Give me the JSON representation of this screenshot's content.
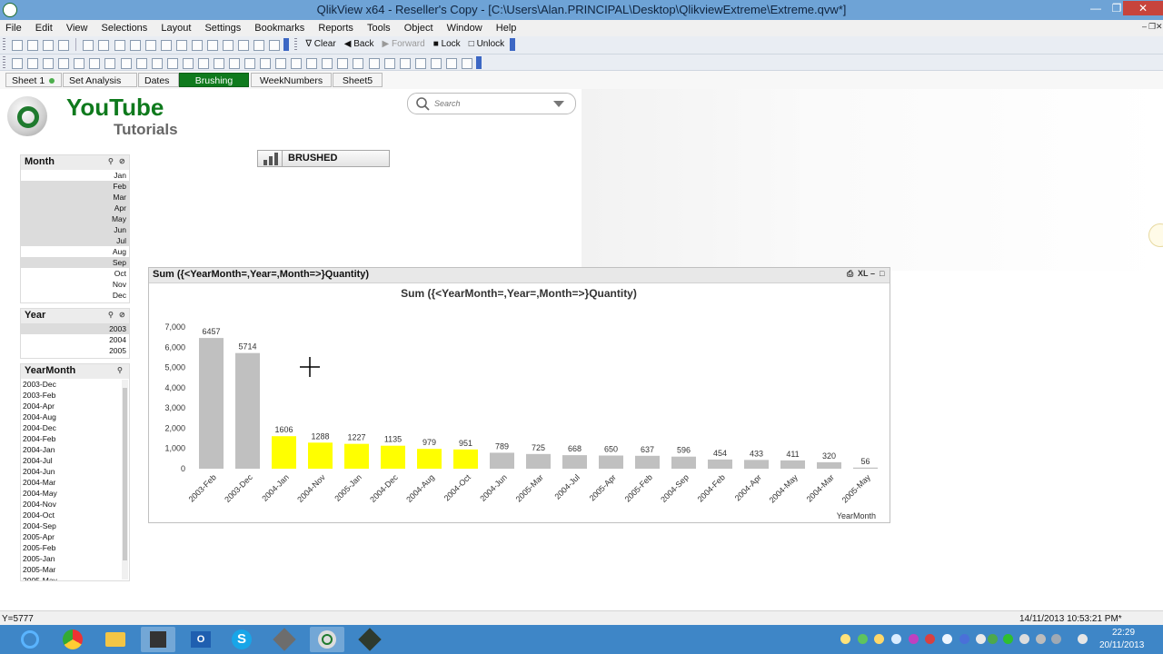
{
  "window": {
    "title": "QlikView x64 - Reseller's Copy - [C:\\Users\\Alan.PRINCIPAL\\Desktop\\QlikviewExtreme\\Extreme.qvw*]",
    "minimize": "—",
    "restore": "❐",
    "close": "✕"
  },
  "menu": [
    "File",
    "Edit",
    "View",
    "Selections",
    "Layout",
    "Settings",
    "Bookmarks",
    "Reports",
    "Tools",
    "Object",
    "Window",
    "Help"
  ],
  "menu_right": {
    "min": "‒",
    "restore": "❐",
    "close": "✕"
  },
  "toolbar": {
    "clear": "Clear",
    "back": "Back",
    "forward": "Forward",
    "lock": "Lock",
    "unlock": "Unlock"
  },
  "tabs": [
    {
      "label": "Sheet 1"
    },
    {
      "label": "Set Analysis"
    },
    {
      "label": "Dates"
    },
    {
      "label": "Brushing"
    },
    {
      "label": "WeekNumbers"
    },
    {
      "label": "Sheet5"
    }
  ],
  "logo": {
    "line1": "YouTube",
    "line2": "Tutorials"
  },
  "search": {
    "placeholder": "Search"
  },
  "brushed_button": {
    "label": "BRUSHED"
  },
  "month_box": {
    "title": "Month",
    "items": [
      {
        "label": "Jan",
        "selected": false
      },
      {
        "label": "Feb",
        "selected": true
      },
      {
        "label": "Mar",
        "selected": true
      },
      {
        "label": "Apr",
        "selected": true
      },
      {
        "label": "May",
        "selected": true
      },
      {
        "label": "Jun",
        "selected": true
      },
      {
        "label": "Jul",
        "selected": true
      },
      {
        "label": "Aug",
        "selected": false
      },
      {
        "label": "Sep",
        "selected": true
      },
      {
        "label": "Oct",
        "selected": false
      },
      {
        "label": "Nov",
        "selected": false
      },
      {
        "label": "Dec",
        "selected": false
      }
    ]
  },
  "year_box": {
    "title": "Year",
    "items": [
      {
        "label": "2003",
        "selected": true
      },
      {
        "label": "2004",
        "selected": false
      },
      {
        "label": "2005",
        "selected": false
      }
    ]
  },
  "yearmonth_box": {
    "title": "YearMonth",
    "items": [
      "2003-Dec",
      "2003-Feb",
      "2004-Apr",
      "2004-Aug",
      "2004-Dec",
      "2004-Feb",
      "2004-Jan",
      "2004-Jul",
      "2004-Jun",
      "2004-Mar",
      "2004-May",
      "2004-Nov",
      "2004-Oct",
      "2004-Sep",
      "2005-Apr",
      "2005-Feb",
      "2005-Jan",
      "2005-Mar",
      "2005-May"
    ]
  },
  "chart_caption": {
    "text": "Sum ({<YearMonth=,Year=,Month=>}Quantity)",
    "xl": "XL"
  },
  "chart_data": {
    "type": "bar",
    "title": "Sum ({<YearMonth=,Year=,Month=>}Quantity)",
    "xlabel": "YearMonth",
    "ylabel": "",
    "ylim": [
      0,
      7000
    ],
    "yticks": [
      "0",
      "1,000",
      "2,000",
      "3,000",
      "4,000",
      "5,000",
      "6,000",
      "7,000"
    ],
    "categories": [
      "2003-Feb",
      "2003-Dec",
      "2004-Jan",
      "2004-Nov",
      "2005-Jan",
      "2004-Dec",
      "2004-Aug",
      "2004-Oct",
      "2004-Jun",
      "2005-Mar",
      "2004-Jul",
      "2005-Apr",
      "2005-Feb",
      "2004-Sep",
      "2004-Feb",
      "2004-Apr",
      "2004-May",
      "2004-Mar",
      "2005-May"
    ],
    "values": [
      6457,
      5714,
      1606,
      1288,
      1227,
      1135,
      979,
      951,
      789,
      725,
      668,
      650,
      637,
      596,
      454,
      433,
      411,
      320,
      56
    ],
    "highlight": [
      false,
      false,
      true,
      true,
      true,
      true,
      true,
      true,
      false,
      false,
      false,
      false,
      false,
      false,
      false,
      false,
      false,
      false,
      false
    ],
    "colors": {
      "normal": "#c0c0c0",
      "highlight": "#ffff00"
    }
  },
  "status": {
    "left": "Y=5777",
    "right": "14/11/2013 10:53:21 PM*"
  },
  "clock": {
    "time": "22:29",
    "date": "20/11/2013"
  }
}
